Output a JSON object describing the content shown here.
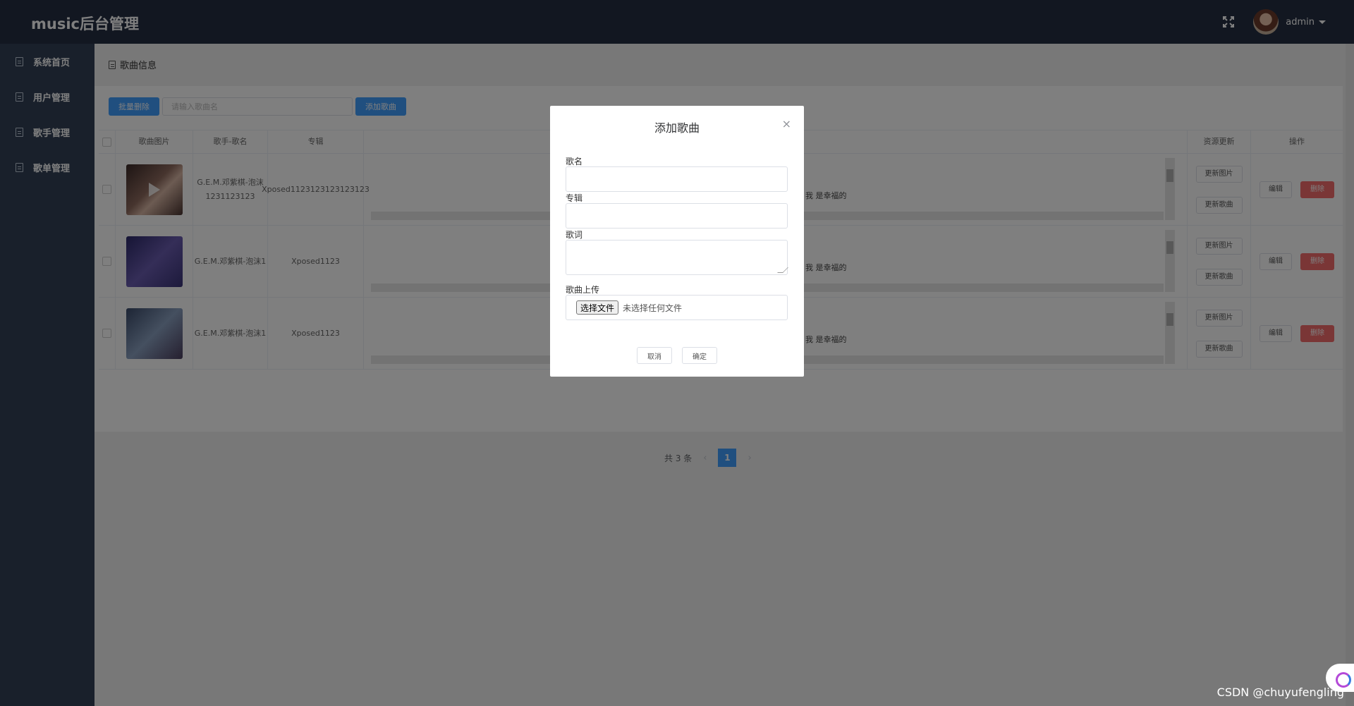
{
  "app": {
    "title": "music后台管理",
    "username": "admin"
  },
  "sidebar": {
    "items": [
      {
        "label": "系统首页"
      },
      {
        "label": "用户管理"
      },
      {
        "label": "歌手管理"
      },
      {
        "label": "歌单管理"
      }
    ]
  },
  "breadcrumb": {
    "label": "歌曲信息"
  },
  "toolbar": {
    "batch_delete_label": "批量删除",
    "search_placeholder": "请输入歌曲名",
    "add_song_label": "添加歌曲"
  },
  "table": {
    "headers": {
      "image": "歌曲图片",
      "singer": "歌手-歌名",
      "album": "专辑",
      "resource": "资源更新",
      "ops": "操作"
    },
    "rows": [
      {
        "singer_song": "G.E.M.邓紫棋-泡沫1231123123",
        "album": "Xposed1123123123123123",
        "lyric_fragment": "我 是幸福的",
        "update_image": "更新图片",
        "update_song": "更新歌曲",
        "edit": "编辑",
        "delete": "删除"
      },
      {
        "singer_song": "G.E.M.邓紫棋-泡沫1",
        "album": "Xposed1123",
        "lyric_fragment": "我 是幸福的",
        "update_image": "更新图片",
        "update_song": "更新歌曲",
        "edit": "编辑",
        "delete": "删除"
      },
      {
        "singer_song": "G.E.M.邓紫棋-泡沫1",
        "album": "Xposed1123",
        "lyric_fragment": "我 是幸福的",
        "update_image": "更新图片",
        "update_song": "更新歌曲",
        "edit": "编辑",
        "delete": "删除"
      }
    ]
  },
  "pagination": {
    "total_text": "共 3 条",
    "current_page": "1"
  },
  "dialog": {
    "title": "添加歌曲",
    "close": "×",
    "name_label": "歌名",
    "album_label": "专辑",
    "lyric_label": "歌词",
    "upload_label": "歌曲上传",
    "file_button": "选择文件",
    "file_status": "未选择任何文件",
    "cancel_label": "取消",
    "confirm_label": "确定"
  },
  "watermark": "CSDN @chuyufengling"
}
